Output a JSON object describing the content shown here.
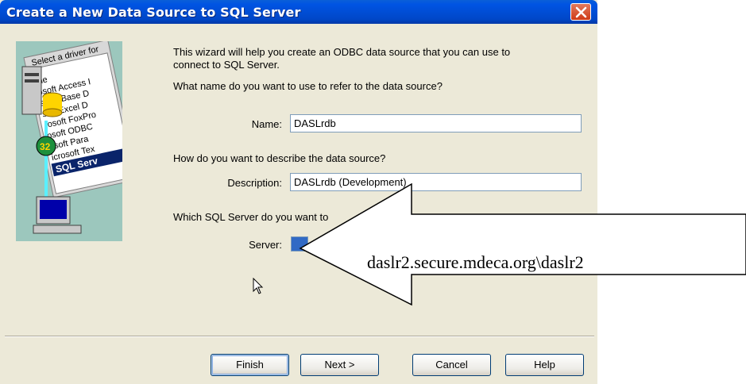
{
  "window": {
    "title": "Create a New Data Source to SQL Server"
  },
  "intro": {
    "line1": "This wizard will help you create an ODBC data source that you can use to",
    "line2": "connect to SQL Server."
  },
  "name_section": {
    "question": "What name do you want to use to refer to the data source?",
    "label": "Name:",
    "value": "DASLrdb"
  },
  "description_section": {
    "question": "How do you want to describe the data source?",
    "label": "Description:",
    "value": "DASLrdb (Development)"
  },
  "server_section": {
    "question": "Which SQL Server do you want to",
    "label": "Server:"
  },
  "buttons": {
    "finish": "Finish",
    "next": "Next >",
    "cancel": "Cancel",
    "help": "Help"
  },
  "illustration": {
    "card_lines": [
      "Select a driver for",
      "me",
      "osoft Access I",
      "soft dBase D",
      "soft Excel D",
      "rosoft FoxPro",
      "osoft ODBC",
      "osoft Para",
      "icrosoft Tex",
      "SQL Serv"
    ],
    "badge": "32"
  },
  "annotation": {
    "callout_text": "daslr2.secure.mdeca.org\\daslr2"
  },
  "colors": {
    "titlebar": "#0054e3",
    "dialog_bg": "#ece9d8",
    "selection": "#316ac5"
  }
}
